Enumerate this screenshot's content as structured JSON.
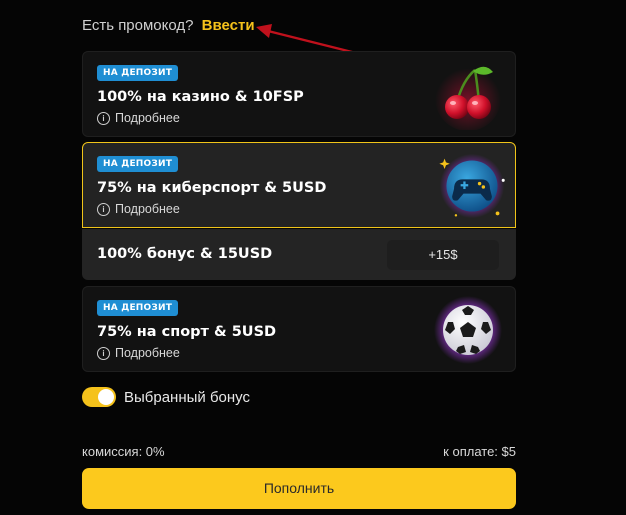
{
  "promo": {
    "question": "Есть промокод?",
    "link": "Ввести"
  },
  "bonuses": [
    {
      "badge": "НА ДЕПОЗИТ",
      "title": "100% на казино & 10FSP",
      "details": "Подробнее",
      "icon": "cherry-icon"
    },
    {
      "badge": "НА ДЕПОЗИТ",
      "title": "75% на киберспорт & 5USD",
      "details": "Подробнее",
      "icon": "gamepad-icon",
      "selected": true
    },
    {
      "badge": "НА ДЕПОЗИТ",
      "title": "75% на спорт & 5USD",
      "details": "Подробнее",
      "icon": "soccer-ball-icon"
    }
  ],
  "extra_bonus": {
    "title": "100% бонус & 15USD",
    "value": "+15$"
  },
  "selected_bonus_toggle": {
    "label": "Выбранный бонус",
    "on": true
  },
  "fees": {
    "commission": "комиссия: 0%",
    "to_pay": "к оплате: $5"
  },
  "deposit_button": "Пополнить",
  "colors": {
    "accent": "#fcc91d",
    "badge": "#1f8ed3",
    "annotation_arrow": "#c0111c"
  }
}
